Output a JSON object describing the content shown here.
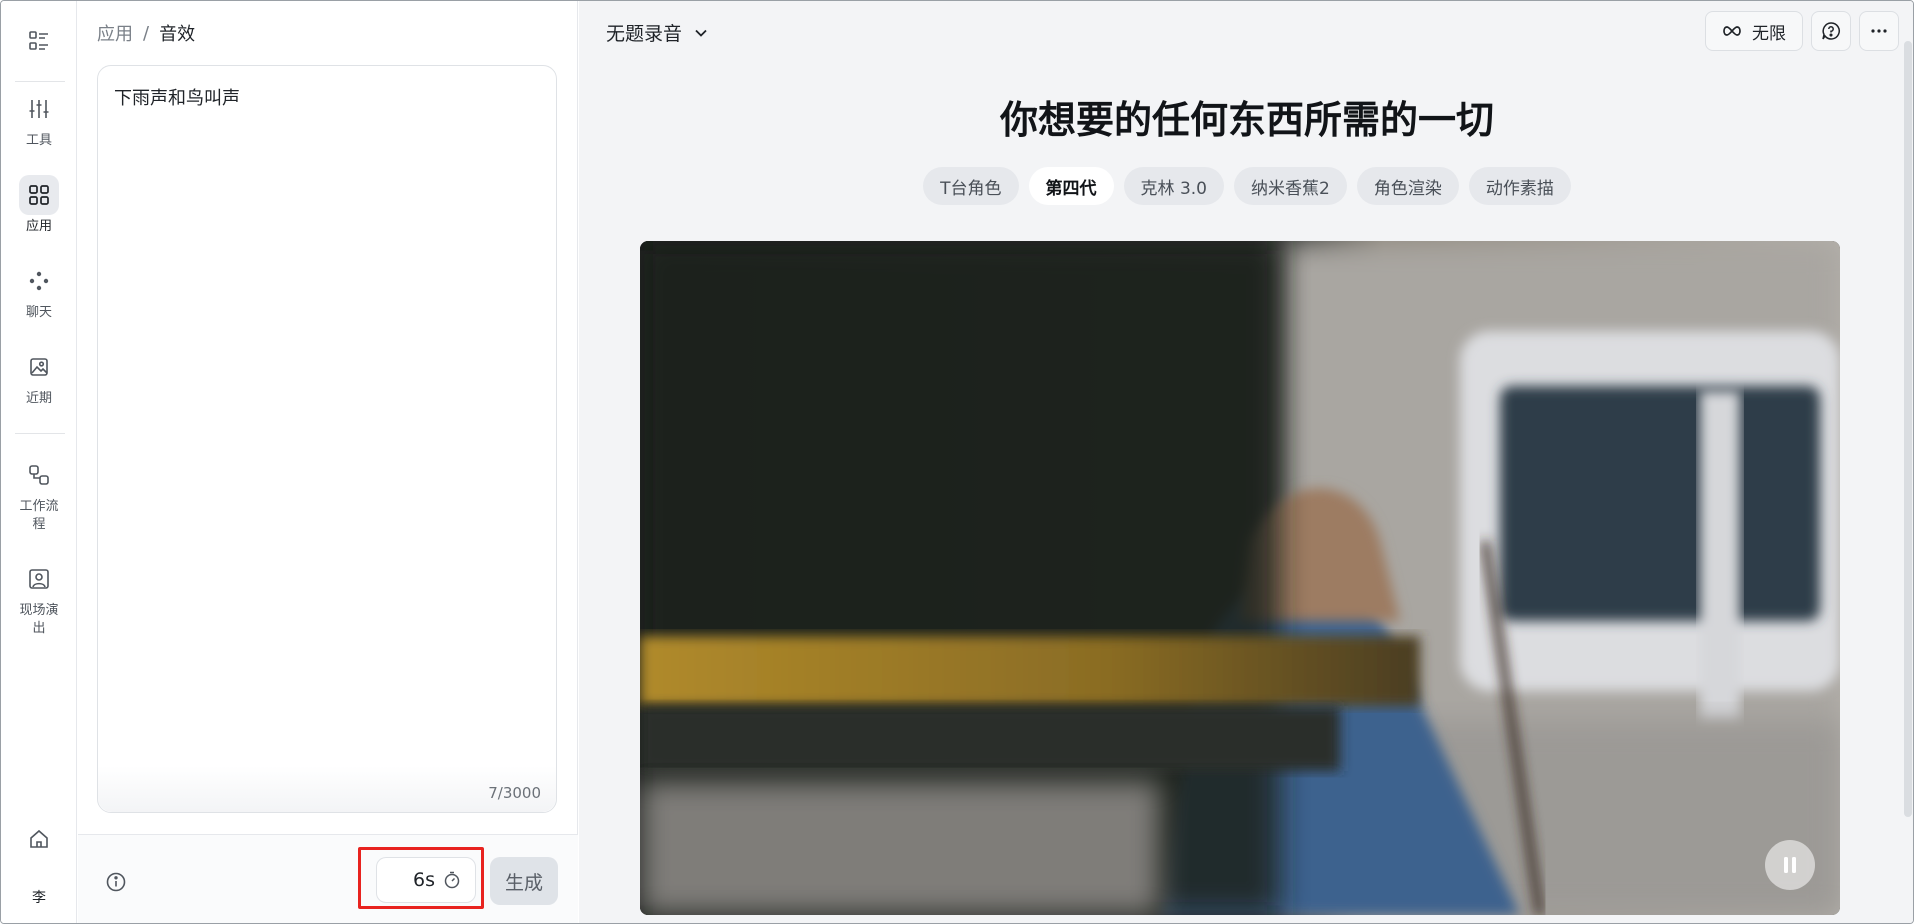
{
  "rail": {
    "items": [
      {
        "label": ""
      },
      {
        "label": "工具"
      },
      {
        "label": "应用"
      },
      {
        "label": "聊天"
      },
      {
        "label": "近期"
      },
      {
        "label": "工作流程"
      },
      {
        "label": "现场演出"
      }
    ],
    "user_initial": "李"
  },
  "left": {
    "breadcrumb": {
      "parent": "应用",
      "sep": "/",
      "current": "音效"
    },
    "prompt": {
      "value": "下雨声和鸟叫声",
      "counter": "7/3000"
    },
    "duration": "6s",
    "generate_label": "生成"
  },
  "main": {
    "project_title": "无题录音",
    "unlimited_label": "无限",
    "headline": "你想要的任何东西所需的一切",
    "chips": [
      {
        "label": "T台角色",
        "active": false
      },
      {
        "label": "第四代",
        "active": true
      },
      {
        "label": "克林 3.0",
        "active": false
      },
      {
        "label": "纳米香蕉2",
        "active": false
      },
      {
        "label": "角色渲染",
        "active": false
      },
      {
        "label": "动作素描",
        "active": false
      }
    ]
  },
  "colors": {
    "highlight": "#e8231f",
    "background": "#f3f4f6"
  }
}
